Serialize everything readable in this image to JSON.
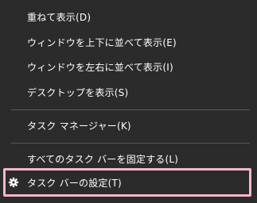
{
  "menu": {
    "items": [
      {
        "label": "重ねて表示(D)"
      },
      {
        "label": "ウィンドウを上下に並べて表示(E)"
      },
      {
        "label": "ウィンドウを左右に並べて表示(I)"
      },
      {
        "label": "デスクトップを表示(S)"
      },
      {
        "label": "タスク マネージャー(K)"
      },
      {
        "label": "すべてのタスク バーを固定する(L)"
      },
      {
        "label": "タスク バーの設定(T)",
        "icon": "gear-icon"
      }
    ]
  },
  "colors": {
    "background": "#2b2b2b",
    "text": "#ffffff",
    "separator": "#5a5a5a",
    "highlight_border": "#f7b6cf"
  }
}
